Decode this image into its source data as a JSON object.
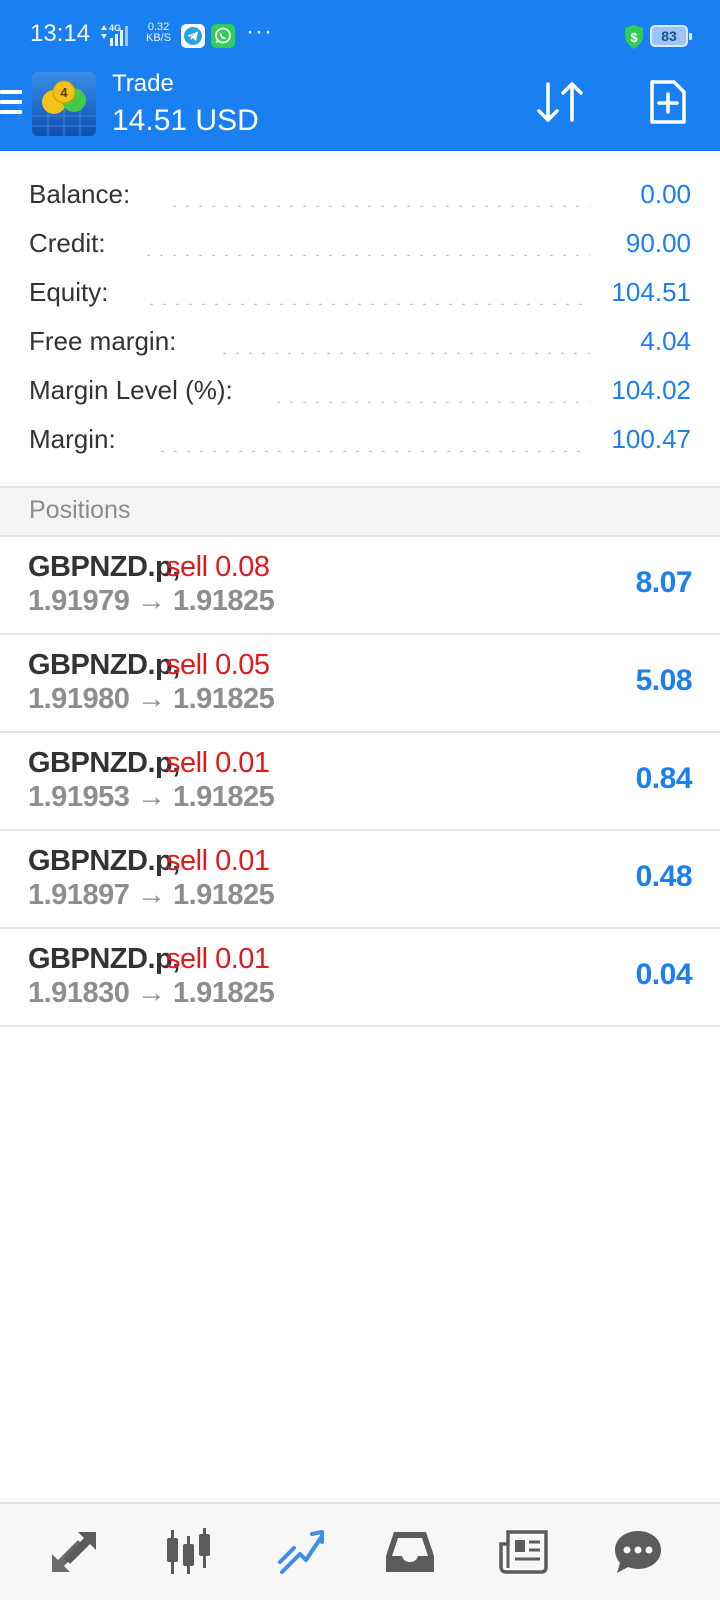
{
  "status_bar": {
    "time": "13:14",
    "network": "4G",
    "speed_value": "0.32",
    "speed_unit": "KB/S",
    "more": "···",
    "battery": "83"
  },
  "app_bar": {
    "title": "Trade",
    "balance": "14.51 USD"
  },
  "account": [
    {
      "label": "Balance:",
      "value": "0.00"
    },
    {
      "label": "Credit:",
      "value": "90.00"
    },
    {
      "label": "Equity:",
      "value": "104.51"
    },
    {
      "label": "Free margin:",
      "value": "4.04"
    },
    {
      "label": "Margin Level (%):",
      "value": "104.02"
    },
    {
      "label": "Margin:",
      "value": "100.47"
    }
  ],
  "positions_title": "Positions",
  "positions": [
    {
      "symbol": "GBPNZD.p,",
      "side": "sell 0.08",
      "prices": "1.91979 → 1.91825",
      "profit": "8.07"
    },
    {
      "symbol": "GBPNZD.p,",
      "side": "sell 0.05",
      "prices": "1.91980 → 1.91825",
      "profit": "5.08"
    },
    {
      "symbol": "GBPNZD.p,",
      "side": "sell 0.01",
      "prices": "1.91953 → 1.91825",
      "profit": "0.84"
    },
    {
      "symbol": "GBPNZD.p,",
      "side": "sell 0.01",
      "prices": "1.91897 → 1.91825",
      "profit": "0.48"
    },
    {
      "symbol": "GBPNZD.p,",
      "side": "sell 0.01",
      "prices": "1.91830 → 1.91825",
      "profit": "0.04"
    }
  ],
  "bottom_nav": [
    {
      "icon": "quotes-icon",
      "active": false
    },
    {
      "icon": "chart-icon",
      "active": false
    },
    {
      "icon": "trade-icon",
      "active": true
    },
    {
      "icon": "history-icon",
      "active": false
    },
    {
      "icon": "news-icon",
      "active": false
    },
    {
      "icon": "chat-icon",
      "active": false
    }
  ],
  "colors": {
    "header": "#1a7ff0",
    "value_blue": "#1a7ff0",
    "sell_red": "#e01b1b",
    "nav_active": "#3f8fe9",
    "nav_inactive": "#5b5b5b"
  }
}
